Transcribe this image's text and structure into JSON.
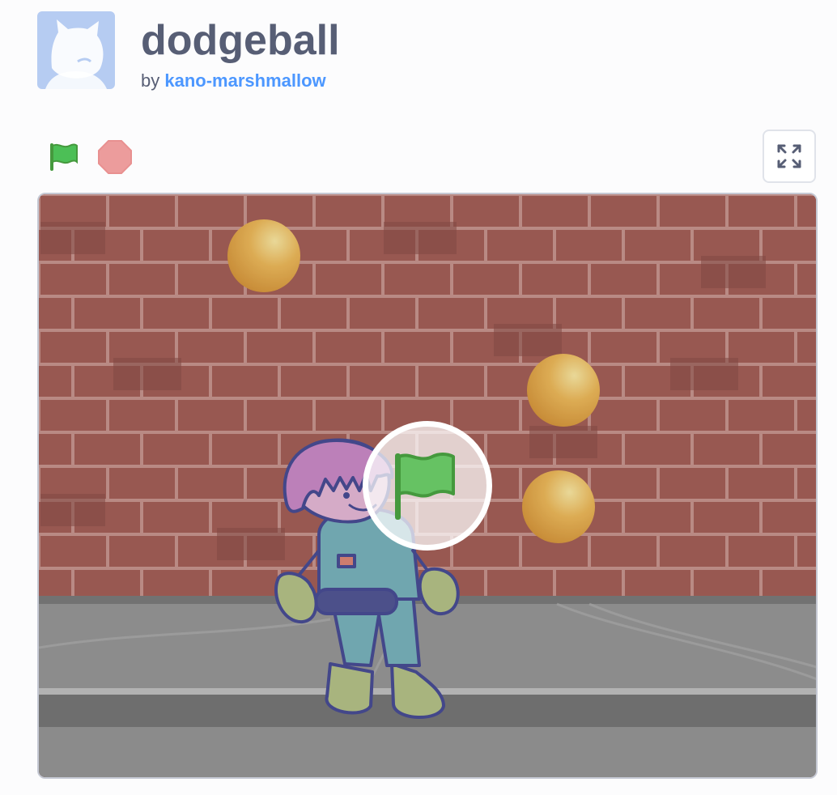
{
  "project": {
    "title": "dodgeball",
    "by_label": "by",
    "author": "kano-marshmallow"
  },
  "controls": {
    "green_flag_icon": "green-flag-icon",
    "stop_icon": "stop-icon",
    "fullscreen_icon": "fullscreen-icon"
  },
  "colors": {
    "title": "#575e75",
    "author_link": "#4c97ff",
    "green_flag": "#4cbf56",
    "stop": "#ec9c9c",
    "brick": "#7f3a32",
    "ground": "#7d7d7d",
    "ball": "#dca33a"
  }
}
